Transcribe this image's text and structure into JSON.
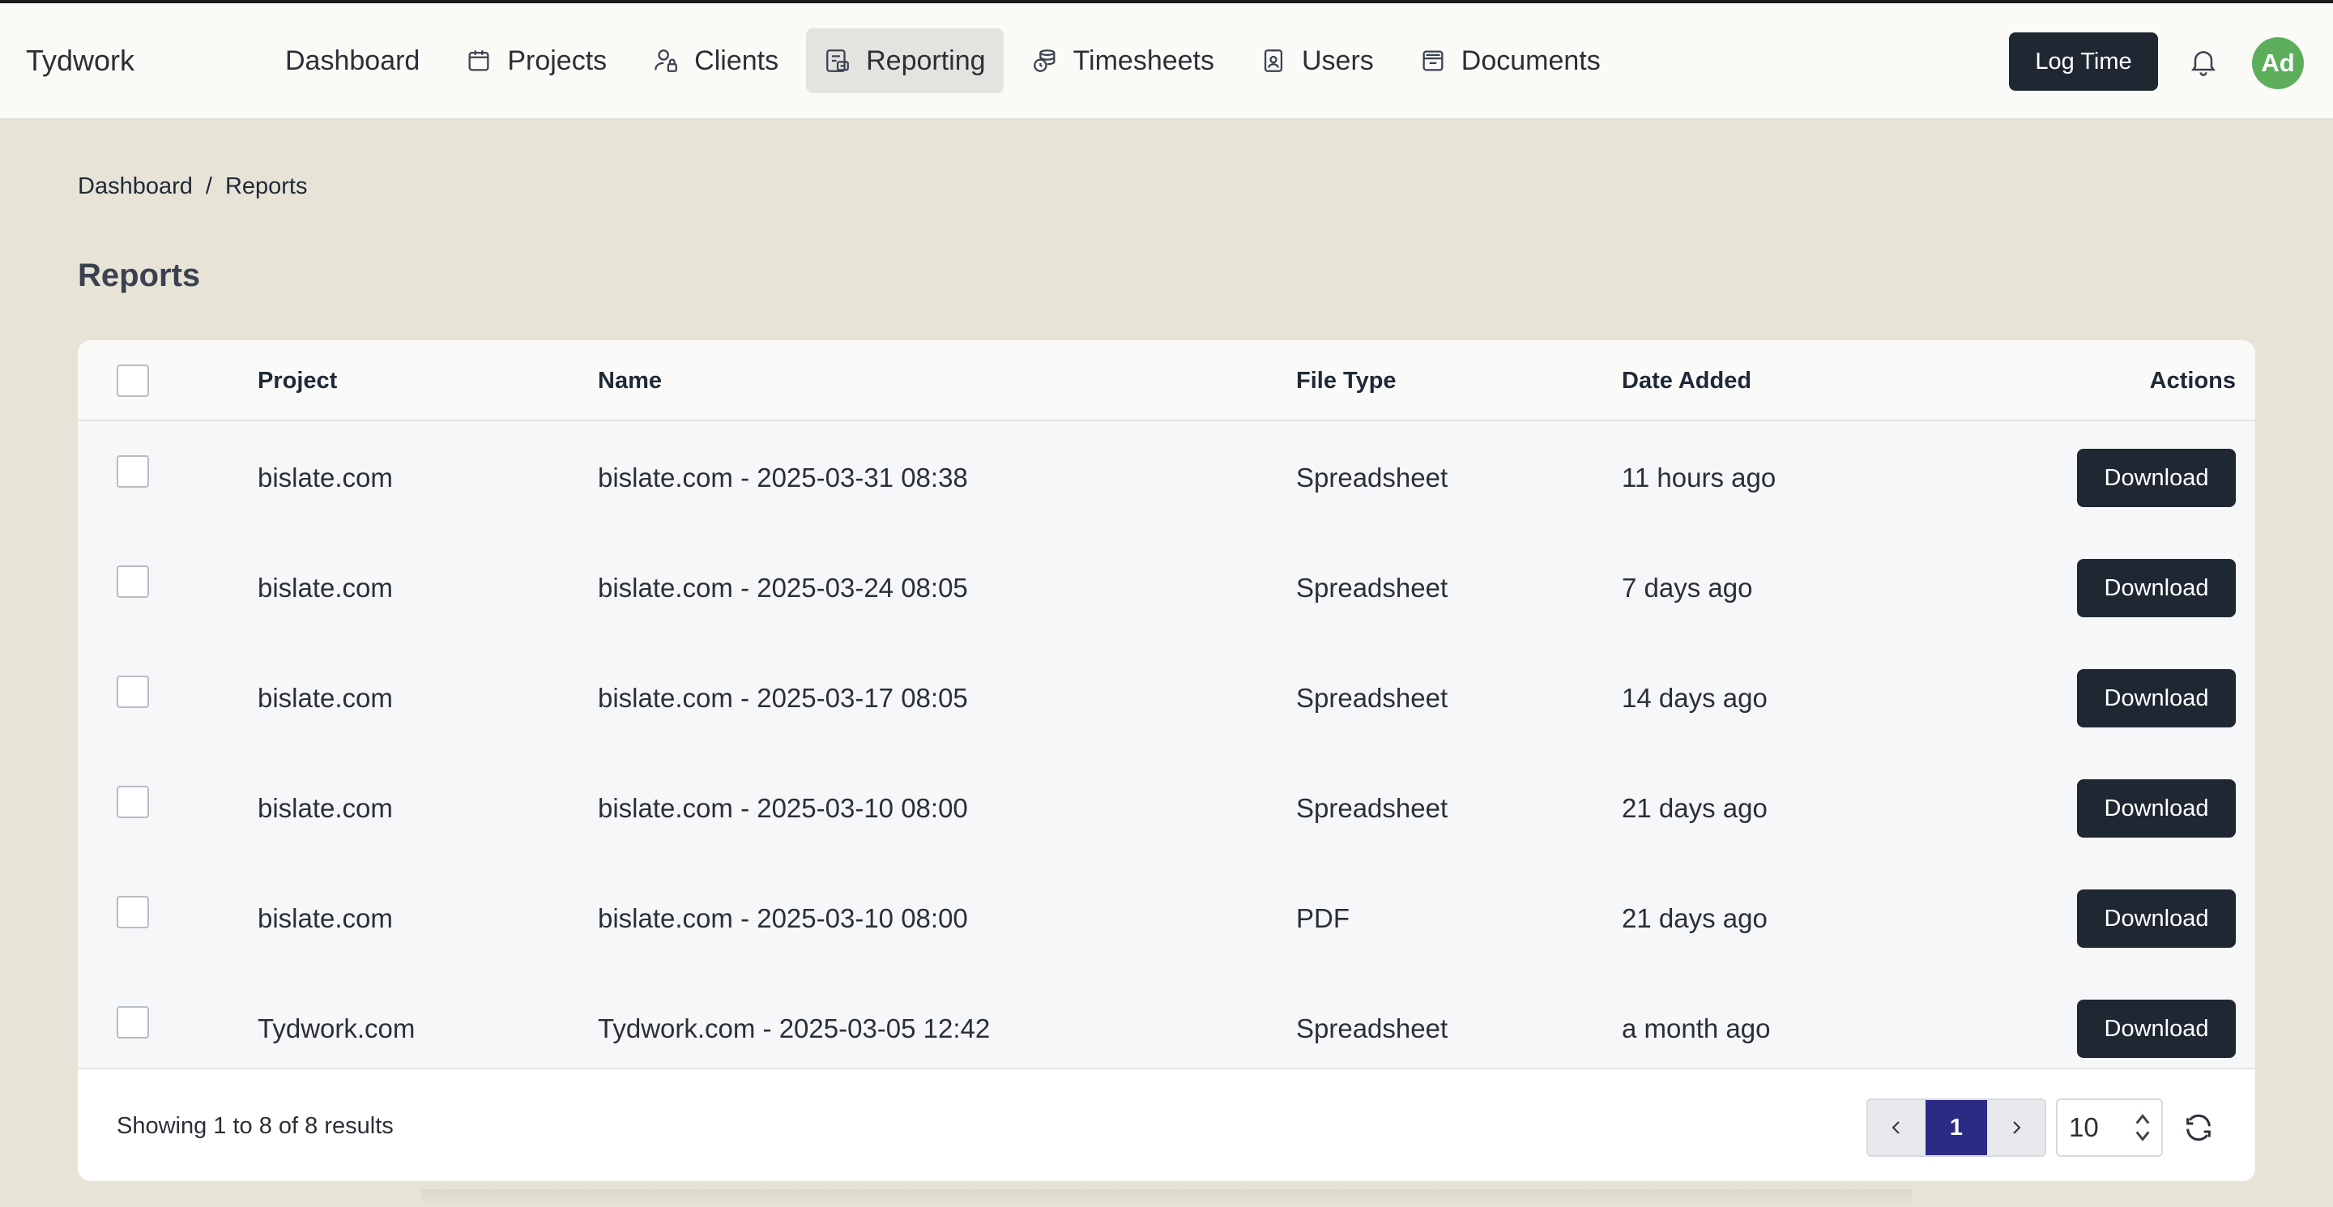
{
  "app": {
    "brand": "Tydwork",
    "nav": [
      {
        "label": "Dashboard",
        "icon": "",
        "active": false
      },
      {
        "label": "Projects",
        "icon": "calendar-icon",
        "active": false
      },
      {
        "label": "Clients",
        "icon": "user-lock-icon",
        "active": false
      },
      {
        "label": "Reporting",
        "icon": "report-icon",
        "active": true
      },
      {
        "label": "Timesheets",
        "icon": "coins-clock-icon",
        "active": false
      },
      {
        "label": "Users",
        "icon": "id-badge-icon",
        "active": false
      },
      {
        "label": "Documents",
        "icon": "archive-icon",
        "active": false
      }
    ],
    "log_time_label": "Log Time",
    "avatar_initials": "Ad"
  },
  "breadcrumb": {
    "items": [
      "Dashboard",
      "Reports"
    ],
    "separator": "/"
  },
  "page_title": "Reports",
  "table": {
    "columns": {
      "project": "Project",
      "name": "Name",
      "file_type": "File Type",
      "date_added": "Date Added",
      "actions": "Actions"
    },
    "rows": [
      {
        "project": "bislate.com",
        "name": "bislate.com - 2025-03-31 08:38",
        "file_type": "Spreadsheet",
        "date_added": "11 hours ago",
        "action": "Download"
      },
      {
        "project": "bislate.com",
        "name": "bislate.com - 2025-03-24 08:05",
        "file_type": "Spreadsheet",
        "date_added": "7 days ago",
        "action": "Download"
      },
      {
        "project": "bislate.com",
        "name": "bislate.com - 2025-03-17 08:05",
        "file_type": "Spreadsheet",
        "date_added": "14 days ago",
        "action": "Download"
      },
      {
        "project": "bislate.com",
        "name": "bislate.com - 2025-03-10 08:00",
        "file_type": "Spreadsheet",
        "date_added": "21 days ago",
        "action": "Download"
      },
      {
        "project": "bislate.com",
        "name": "bislate.com - 2025-03-10 08:00",
        "file_type": "PDF",
        "date_added": "21 days ago",
        "action": "Download"
      },
      {
        "project": "Tydwork.com",
        "name": "Tydwork.com - 2025-03-05 12:42",
        "file_type": "Spreadsheet",
        "date_added": "a month ago",
        "action": "Download"
      }
    ]
  },
  "pagination": {
    "summary": "Showing 1 to 8 of 8 results",
    "current_page": "1",
    "per_page": "10",
    "prev_icon": "chevron-left-icon",
    "next_icon": "chevron-right-icon",
    "refresh_icon": "refresh-icon"
  },
  "colors": {
    "background": "#e8e3d7",
    "primary_button": "#1f2733",
    "active_page": "#2b2a84",
    "avatar": "#5cae5b"
  }
}
